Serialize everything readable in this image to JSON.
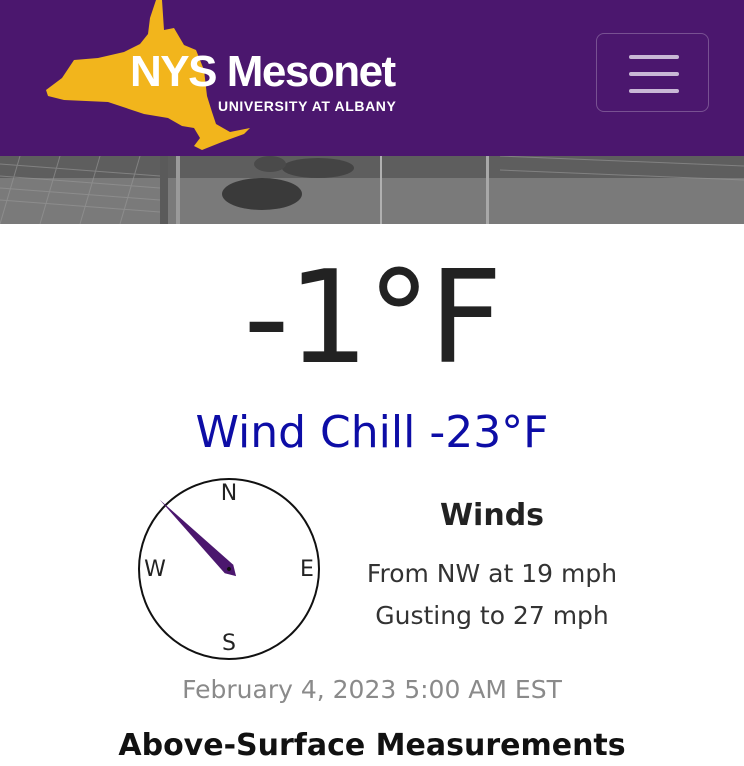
{
  "header": {
    "logo": {
      "title_part1": "NYS",
      "title_part2": "Mesonet",
      "subtitle": "UNIVERSITY AT ALBANY"
    },
    "menu_button_icon": "hamburger-icon",
    "colors": {
      "header_bg": "#4b176e",
      "state_shape": "#f2b51c",
      "menu_bars": "#c9b8d6"
    }
  },
  "camera": {
    "description_icon": "webcam-image"
  },
  "current": {
    "temperature": "-1°F",
    "wind_chill": "Wind Chill -23°F",
    "wind_chill_color": "#0d0da6"
  },
  "compass": {
    "north": "N",
    "east": "E",
    "south": "S",
    "west": "W",
    "needle_color": "#4b176e",
    "wind_direction_degrees": 315
  },
  "winds": {
    "title": "Winds",
    "from": "From NW at 19 mph",
    "gusts": "Gusting to 27 mph"
  },
  "observation_time": "February 4, 2023 5:00 AM EST",
  "next_section": {
    "title": "Above-Surface Measurements"
  }
}
